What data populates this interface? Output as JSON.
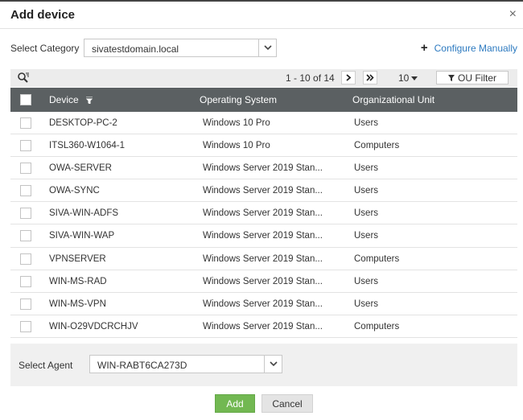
{
  "dialog": {
    "title": "Add device",
    "close_label": "×"
  },
  "category": {
    "label": "Select Category",
    "value": "sivatestdomain.local"
  },
  "configure": {
    "plus": "+",
    "label": "Configure Manually"
  },
  "toolbar": {
    "page_info": "1 - 10 of 14",
    "per_page": "10",
    "ou_filter": "OU Filter"
  },
  "table": {
    "headers": [
      "Device",
      "Operating System",
      "Organizational Unit"
    ],
    "rows": [
      [
        "DESKTOP-PC-2",
        "Windows 10 Pro",
        "Users"
      ],
      [
        "ITSL360-W1064-1",
        "Windows 10 Pro",
        "Computers"
      ],
      [
        "OWA-SERVER",
        "Windows Server 2019 Stan...",
        "Users"
      ],
      [
        "OWA-SYNC",
        "Windows Server 2019 Stan...",
        "Users"
      ],
      [
        "SIVA-WIN-ADFS",
        "Windows Server 2019 Stan...",
        "Users"
      ],
      [
        "SIVA-WIN-WAP",
        "Windows Server 2019 Stan...",
        "Users"
      ],
      [
        "VPNSERVER",
        "Windows Server 2019 Stan...",
        "Computers"
      ],
      [
        "WIN-MS-RAD",
        "Windows Server 2019 Stan...",
        "Users"
      ],
      [
        "WIN-MS-VPN",
        "Windows Server 2019 Stan...",
        "Users"
      ],
      [
        "WIN-O29VDCRCHJV",
        "Windows Server 2019 Stan...",
        "Computers"
      ]
    ]
  },
  "agent": {
    "label": "Select Agent",
    "value": "WIN-RABT6CA273D"
  },
  "footer": {
    "add_label": "Add",
    "cancel_label": "Cancel"
  },
  "colors": {
    "header_bg": "#5b6062",
    "link": "#2d7ac0",
    "add_button": "#72b852"
  }
}
